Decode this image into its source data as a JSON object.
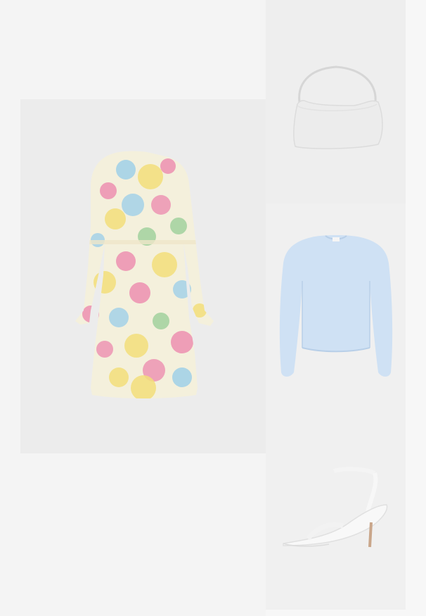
{
  "outfit": {
    "items": [
      {
        "id": "dress",
        "icon": "floral-dress-image",
        "colors": {
          "base": "#f4f0dc",
          "pink": "#ec8fb0",
          "yellow": "#f2de7a",
          "blue": "#9fd0e8",
          "green": "#9ccf9a"
        }
      },
      {
        "id": "bag",
        "icon": "white-handbag-image",
        "colors": {
          "base": "#ececec",
          "handle": "#d9d9d9"
        }
      },
      {
        "id": "sweater",
        "icon": "light-blue-sweater-image",
        "colors": {
          "base": "#cfe1f4",
          "shade": "#b8cfe8"
        }
      },
      {
        "id": "sandal",
        "icon": "white-heeled-sandal-image",
        "colors": {
          "base": "#f8f8f8",
          "heel": "#c9a68a"
        }
      }
    ]
  },
  "colors": {
    "page_background": "#f4f4f4",
    "tile_background": "#ececec"
  }
}
